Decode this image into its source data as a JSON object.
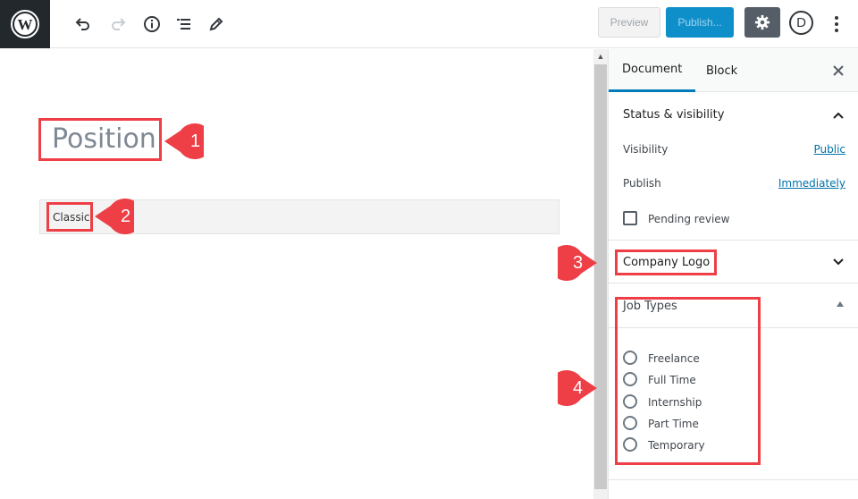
{
  "toolbar": {
    "logo_icon": "wordpress-logo-icon",
    "undo_icon": "undo-icon",
    "redo_icon": "redo-icon",
    "info_icon": "info-icon",
    "outline_icon": "block-navigation-icon",
    "tools_icon": "pencil-icon",
    "preview_label": "Preview",
    "publish_label": "Publish...",
    "settings_icon": "gear-icon",
    "divi_label": "D",
    "more_icon": "more-vertical-icon"
  },
  "editor": {
    "title": "Position",
    "classic_block_label": "Classic"
  },
  "sidebar": {
    "tabs": [
      {
        "label": "Document",
        "active": true
      },
      {
        "label": "Block",
        "active": false
      }
    ],
    "close_icon": "close-icon",
    "status_panel": {
      "title": "Status & visibility",
      "expanded": true,
      "visibility_label": "Visibility",
      "visibility_value": "Public",
      "publish_label": "Publish",
      "publish_value": "Immediately",
      "pending_review_label": "Pending review",
      "pending_review_checked": false
    },
    "company_logo_panel": {
      "title": "Company Logo",
      "expanded": false
    },
    "job_types_panel": {
      "title": "Job Types",
      "expanded": true,
      "options": [
        {
          "label": "Freelance",
          "selected": false
        },
        {
          "label": "Full Time",
          "selected": false
        },
        {
          "label": "Internship",
          "selected": false
        },
        {
          "label": "Part Time",
          "selected": false
        },
        {
          "label": "Temporary",
          "selected": false
        }
      ]
    }
  },
  "annotations": {
    "color": "#ee3e46",
    "markers": [
      "1",
      "2",
      "3",
      "4"
    ]
  }
}
